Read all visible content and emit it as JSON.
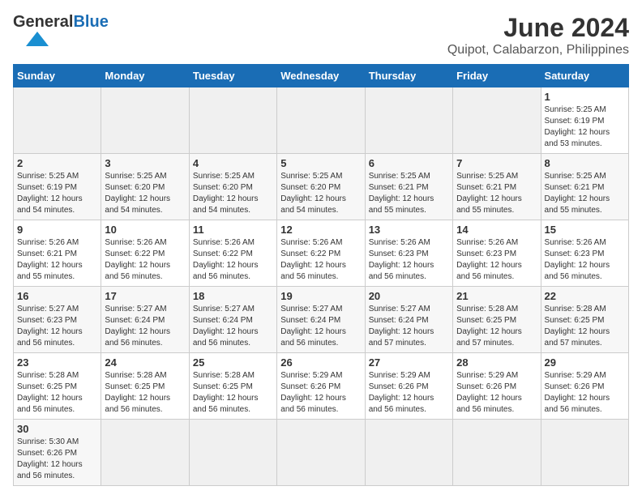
{
  "header": {
    "logo_text_general": "General",
    "logo_text_blue": "Blue",
    "title": "June 2024",
    "subtitle": "Quipot, Calabarzon, Philippines"
  },
  "weekdays": [
    "Sunday",
    "Monday",
    "Tuesday",
    "Wednesday",
    "Thursday",
    "Friday",
    "Saturday"
  ],
  "days": [
    {
      "date": "",
      "info": "",
      "empty": true
    },
    {
      "date": "",
      "info": "",
      "empty": true
    },
    {
      "date": "",
      "info": "",
      "empty": true
    },
    {
      "date": "",
      "info": "",
      "empty": true
    },
    {
      "date": "",
      "info": "",
      "empty": true
    },
    {
      "date": "",
      "info": "",
      "empty": true
    },
    {
      "date": "1",
      "info": "Sunrise: 5:25 AM\nSunset: 6:19 PM\nDaylight: 12 hours\nand 53 minutes.",
      "empty": false
    },
    {
      "date": "2",
      "info": "Sunrise: 5:25 AM\nSunset: 6:19 PM\nDaylight: 12 hours\nand 54 minutes.",
      "empty": false
    },
    {
      "date": "3",
      "info": "Sunrise: 5:25 AM\nSunset: 6:20 PM\nDaylight: 12 hours\nand 54 minutes.",
      "empty": false
    },
    {
      "date": "4",
      "info": "Sunrise: 5:25 AM\nSunset: 6:20 PM\nDaylight: 12 hours\nand 54 minutes.",
      "empty": false
    },
    {
      "date": "5",
      "info": "Sunrise: 5:25 AM\nSunset: 6:20 PM\nDaylight: 12 hours\nand 54 minutes.",
      "empty": false
    },
    {
      "date": "6",
      "info": "Sunrise: 5:25 AM\nSunset: 6:21 PM\nDaylight: 12 hours\nand 55 minutes.",
      "empty": false
    },
    {
      "date": "7",
      "info": "Sunrise: 5:25 AM\nSunset: 6:21 PM\nDaylight: 12 hours\nand 55 minutes.",
      "empty": false
    },
    {
      "date": "8",
      "info": "Sunrise: 5:25 AM\nSunset: 6:21 PM\nDaylight: 12 hours\nand 55 minutes.",
      "empty": false
    },
    {
      "date": "9",
      "info": "Sunrise: 5:26 AM\nSunset: 6:21 PM\nDaylight: 12 hours\nand 55 minutes.",
      "empty": false
    },
    {
      "date": "10",
      "info": "Sunrise: 5:26 AM\nSunset: 6:22 PM\nDaylight: 12 hours\nand 56 minutes.",
      "empty": false
    },
    {
      "date": "11",
      "info": "Sunrise: 5:26 AM\nSunset: 6:22 PM\nDaylight: 12 hours\nand 56 minutes.",
      "empty": false
    },
    {
      "date": "12",
      "info": "Sunrise: 5:26 AM\nSunset: 6:22 PM\nDaylight: 12 hours\nand 56 minutes.",
      "empty": false
    },
    {
      "date": "13",
      "info": "Sunrise: 5:26 AM\nSunset: 6:23 PM\nDaylight: 12 hours\nand 56 minutes.",
      "empty": false
    },
    {
      "date": "14",
      "info": "Sunrise: 5:26 AM\nSunset: 6:23 PM\nDaylight: 12 hours\nand 56 minutes.",
      "empty": false
    },
    {
      "date": "15",
      "info": "Sunrise: 5:26 AM\nSunset: 6:23 PM\nDaylight: 12 hours\nand 56 minutes.",
      "empty": false
    },
    {
      "date": "16",
      "info": "Sunrise: 5:27 AM\nSunset: 6:23 PM\nDaylight: 12 hours\nand 56 minutes.",
      "empty": false
    },
    {
      "date": "17",
      "info": "Sunrise: 5:27 AM\nSunset: 6:24 PM\nDaylight: 12 hours\nand 56 minutes.",
      "empty": false
    },
    {
      "date": "18",
      "info": "Sunrise: 5:27 AM\nSunset: 6:24 PM\nDaylight: 12 hours\nand 56 minutes.",
      "empty": false
    },
    {
      "date": "19",
      "info": "Sunrise: 5:27 AM\nSunset: 6:24 PM\nDaylight: 12 hours\nand 56 minutes.",
      "empty": false
    },
    {
      "date": "20",
      "info": "Sunrise: 5:27 AM\nSunset: 6:24 PM\nDaylight: 12 hours\nand 57 minutes.",
      "empty": false
    },
    {
      "date": "21",
      "info": "Sunrise: 5:28 AM\nSunset: 6:25 PM\nDaylight: 12 hours\nand 57 minutes.",
      "empty": false
    },
    {
      "date": "22",
      "info": "Sunrise: 5:28 AM\nSunset: 6:25 PM\nDaylight: 12 hours\nand 57 minutes.",
      "empty": false
    },
    {
      "date": "23",
      "info": "Sunrise: 5:28 AM\nSunset: 6:25 PM\nDaylight: 12 hours\nand 56 minutes.",
      "empty": false
    },
    {
      "date": "24",
      "info": "Sunrise: 5:28 AM\nSunset: 6:25 PM\nDaylight: 12 hours\nand 56 minutes.",
      "empty": false
    },
    {
      "date": "25",
      "info": "Sunrise: 5:28 AM\nSunset: 6:25 PM\nDaylight: 12 hours\nand 56 minutes.",
      "empty": false
    },
    {
      "date": "26",
      "info": "Sunrise: 5:29 AM\nSunset: 6:26 PM\nDaylight: 12 hours\nand 56 minutes.",
      "empty": false
    },
    {
      "date": "27",
      "info": "Sunrise: 5:29 AM\nSunset: 6:26 PM\nDaylight: 12 hours\nand 56 minutes.",
      "empty": false
    },
    {
      "date": "28",
      "info": "Sunrise: 5:29 AM\nSunset: 6:26 PM\nDaylight: 12 hours\nand 56 minutes.",
      "empty": false
    },
    {
      "date": "29",
      "info": "Sunrise: 5:29 AM\nSunset: 6:26 PM\nDaylight: 12 hours\nand 56 minutes.",
      "empty": false
    },
    {
      "date": "30",
      "info": "Sunrise: 5:30 AM\nSunset: 6:26 PM\nDaylight: 12 hours\nand 56 minutes.",
      "empty": false
    },
    {
      "date": "",
      "info": "",
      "empty": true
    },
    {
      "date": "",
      "info": "",
      "empty": true
    },
    {
      "date": "",
      "info": "",
      "empty": true
    },
    {
      "date": "",
      "info": "",
      "empty": true
    },
    {
      "date": "",
      "info": "",
      "empty": true
    },
    {
      "date": "",
      "info": "",
      "empty": true
    }
  ]
}
